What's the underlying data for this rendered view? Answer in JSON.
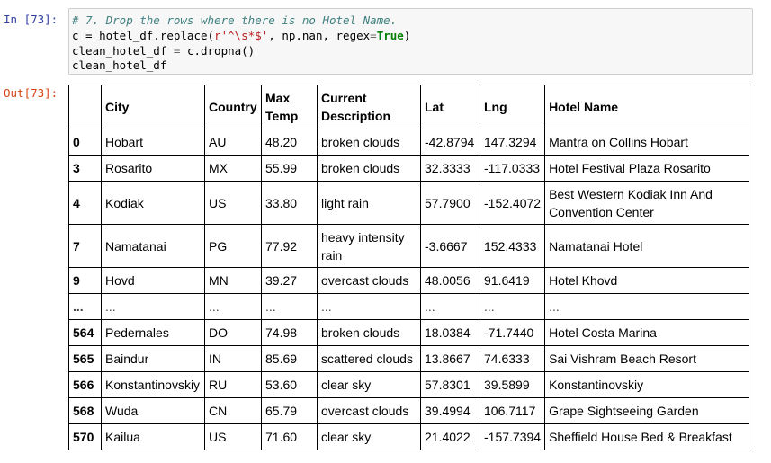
{
  "cell": {
    "in_prompt": "In [73]:",
    "out_prompt": "Out[73]:",
    "code": {
      "line1_comment": "# 7. Drop the rows where there is no Hotel Name.",
      "line2_a": "c = hotel_df.replace(",
      "line2_str": "r'^\\s*$'",
      "line2_b": ", np.nan, regex",
      "line2_eq": "=",
      "line2_kw": "True",
      "line2_c": ")",
      "line3_a": "clean_hotel_df ",
      "line3_eq": "=",
      "line3_b": " c.dropna()",
      "line4": "clean_hotel_df"
    }
  },
  "table": {
    "columns": {
      "city": "City",
      "country": "Country",
      "max_temp_1": "Max",
      "max_temp_2": "Temp",
      "desc_1": "Current",
      "desc_2": "Description",
      "lat": "Lat",
      "lng": "Lng",
      "hotel": "Hotel Name"
    },
    "rows": [
      {
        "idx": "0",
        "city": "Hobart",
        "country": "AU",
        "temp": "48.20",
        "desc": "broken clouds",
        "lat": "-42.8794",
        "lng": "147.3294",
        "hotel": "Mantra on Collins Hobart"
      },
      {
        "idx": "3",
        "city": "Rosarito",
        "country": "MX",
        "temp": "55.99",
        "desc": "broken clouds",
        "lat": "32.3333",
        "lng": "-117.0333",
        "hotel": "Hotel Festival Plaza Rosarito"
      },
      {
        "idx": "4",
        "city": "Kodiak",
        "country": "US",
        "temp": "33.80",
        "desc": "light rain",
        "lat": "57.7900",
        "lng": "-152.4072",
        "hotel": "Best Western Kodiak Inn And Convention Center"
      },
      {
        "idx": "7",
        "city": "Namatanai",
        "country": "PG",
        "temp": "77.92",
        "desc": "heavy intensity rain",
        "lat": "-3.6667",
        "lng": "152.4333",
        "hotel": "Namatanai Hotel"
      },
      {
        "idx": "9",
        "city": "Hovd",
        "country": "MN",
        "temp": "39.27",
        "desc": "overcast clouds",
        "lat": "48.0056",
        "lng": "91.6419",
        "hotel": "Hotel Khovd"
      },
      {
        "idx": "...",
        "city": "...",
        "country": "...",
        "temp": "...",
        "desc": "...",
        "lat": "...",
        "lng": "...",
        "hotel": "..."
      },
      {
        "idx": "564",
        "city": "Pedernales",
        "country": "DO",
        "temp": "74.98",
        "desc": "broken clouds",
        "lat": "18.0384",
        "lng": "-71.7440",
        "hotel": "Hotel Costa Marina"
      },
      {
        "idx": "565",
        "city": "Baindur",
        "country": "IN",
        "temp": "85.69",
        "desc": "scattered clouds",
        "lat": "13.8667",
        "lng": "74.6333",
        "hotel": "Sai Vishram Beach Resort"
      },
      {
        "idx": "566",
        "city": "Konstantinovskiy",
        "country": "RU",
        "temp": "53.60",
        "desc": "clear sky",
        "lat": "57.8301",
        "lng": "39.5899",
        "hotel": "Konstantinovskiy"
      },
      {
        "idx": "568",
        "city": "Wuda",
        "country": "CN",
        "temp": "65.79",
        "desc": "overcast clouds",
        "lat": "39.4994",
        "lng": "106.7117",
        "hotel": "Grape Sightseeing Garden"
      },
      {
        "idx": "570",
        "city": "Kailua",
        "country": "US",
        "temp": "71.60",
        "desc": "clear sky",
        "lat": "21.4022",
        "lng": "-157.7394",
        "hotel": "Sheffield House Bed & Breakfast"
      }
    ]
  }
}
